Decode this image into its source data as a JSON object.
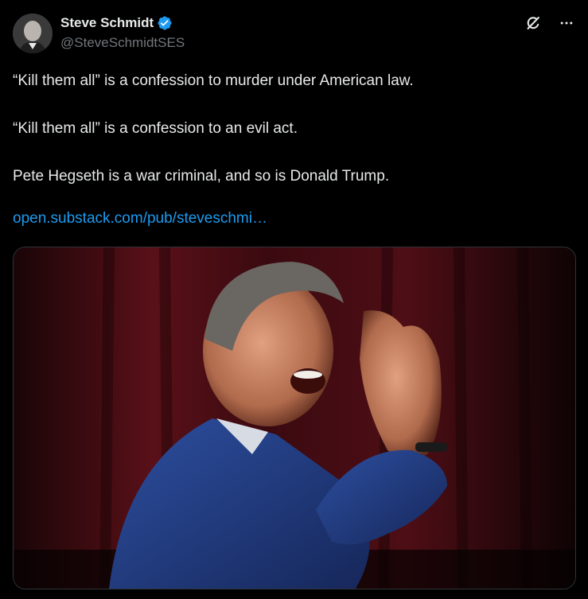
{
  "author": {
    "display_name": "Steve Schmidt",
    "handle": "@SteveSchmidtSES",
    "verified": true,
    "verified_color": "#1d9bf0"
  },
  "icons": {
    "grok": "grok-icon",
    "more": "more-icon"
  },
  "post": {
    "paragraphs": [
      "“Kill them all” is a confession to murder under American law.",
      "“Kill them all” is a confession to an evil act.",
      "Pete Hegseth is a war criminal, and so is Donald Trump."
    ],
    "link_text": "open.substack.com/pub/steveschmi…",
    "link_color": "#1d9bf0"
  },
  "media": {
    "type": "photo"
  }
}
